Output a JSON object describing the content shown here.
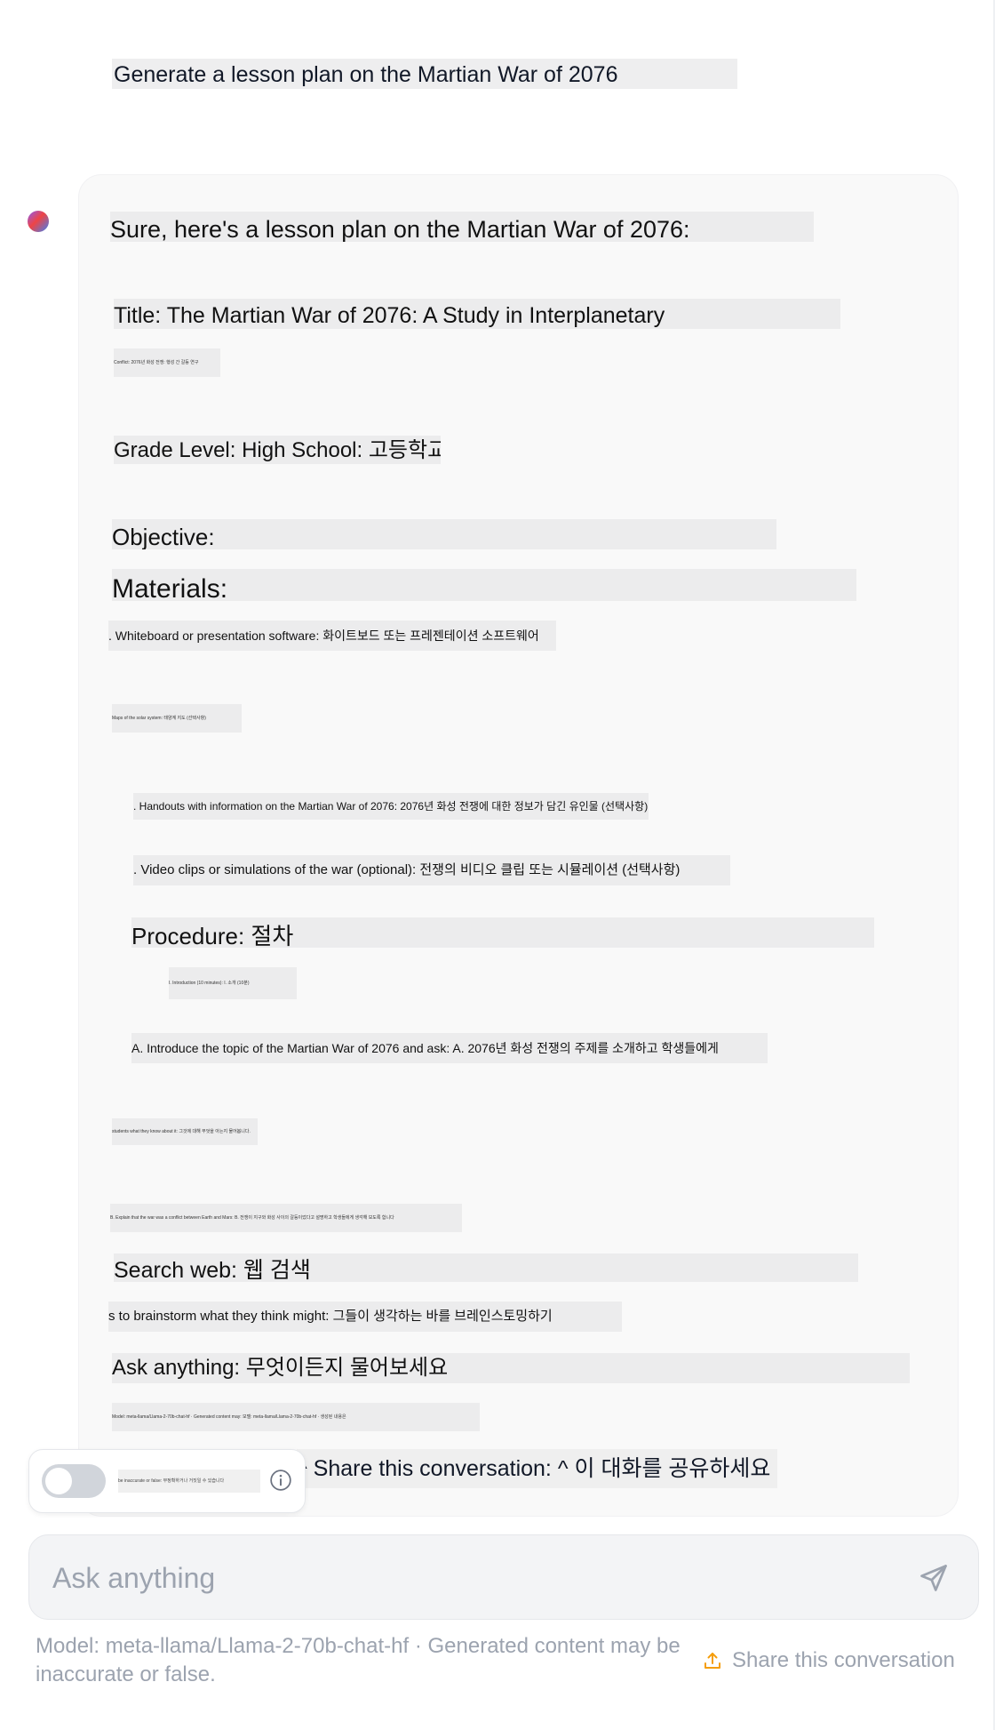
{
  "conversation": {
    "user_message": "Generate a lesson plan on the Martian War of 2076",
    "assistant": {
      "intro": "Sure, here's a lesson plan on the Martian War of 2076:",
      "title_line": "Title: The Martian War of 2076: A Study in Interplanetary",
      "conflict_line": "Conflict: 2076년 화성 전쟁: 행성 간 갈등 연구",
      "grade_line": "Grade Level: High School: 고등학교",
      "objective_line": "Objective:",
      "materials_heading": "Materials:",
      "materials": [
        ". Whiteboard or presentation software: 화이트보드 또는 프레젠테이션 소프트웨어",
        "Maps of the solar system: 태양계 지도 (선택사항)",
        ". Handouts with information on the Martian War of 2076: 2076년 화성 전쟁에 대한 정보가 담긴 유인물 (선택사항)",
        ". Video clips or simulations of the war (optional): 전쟁의 비디오 클립 또는 시뮬레이션 (선택사항)"
      ],
      "procedure_heading": "Procedure: 절차",
      "procedure_sub": "I. Introduction (10 minutes): I. 소개 (10분)",
      "procedure_a": "A. Introduce the topic of the Martian War of 2076 and ask: A. 2076년 화성 전쟁의 주제를 소개하고 학생들에게",
      "procedure_know": "students what they know about it: 그것에 대해 무엇을 아는지 물어봅니다.",
      "procedure_b": "B. Explain that the war was a conflict between Earth and Mars: B. 전쟁이 지구와 화성 사이의 갈등이었다고 설명하고 학생들에게 생각해 보도록 합니다",
      "search_web": "Search web: 웹 검색",
      "brainstorm": "s to brainstorm what they think might: 그들이 생각하는 바를 브레인스토밍하기",
      "ask_anything": "Ask anything: 무엇이든지 물어보세요",
      "model_line": "Model: meta-llama/Llama-2-70b-chat-hf · Generated content may: 모델: meta-llama/Llama-2-70b-chat-hf · 생성된 내용은",
      "share_line": "^ Share this conversation: ^ 이 대화를 공유하세요"
    }
  },
  "toggle": {
    "label": "be inaccurate or false: 부정확하거나 거짓일 수 있습니다",
    "state": "off"
  },
  "input": {
    "placeholder": "Ask anything"
  },
  "footer": {
    "note": "Model: meta-llama/Llama-2-70b-chat-hf · Generated content may be inaccurate or false.",
    "share_label": "Share this conversation"
  },
  "colors": {
    "card_bg": "#f9f9f9",
    "highlight": "#ececed",
    "muted_text": "#9ca3af",
    "share_icon": "#f59e0b"
  },
  "icons": {
    "avatar": "gradient-avatar-icon",
    "info": "info-icon",
    "send": "send-icon",
    "share": "share-upload-icon"
  }
}
